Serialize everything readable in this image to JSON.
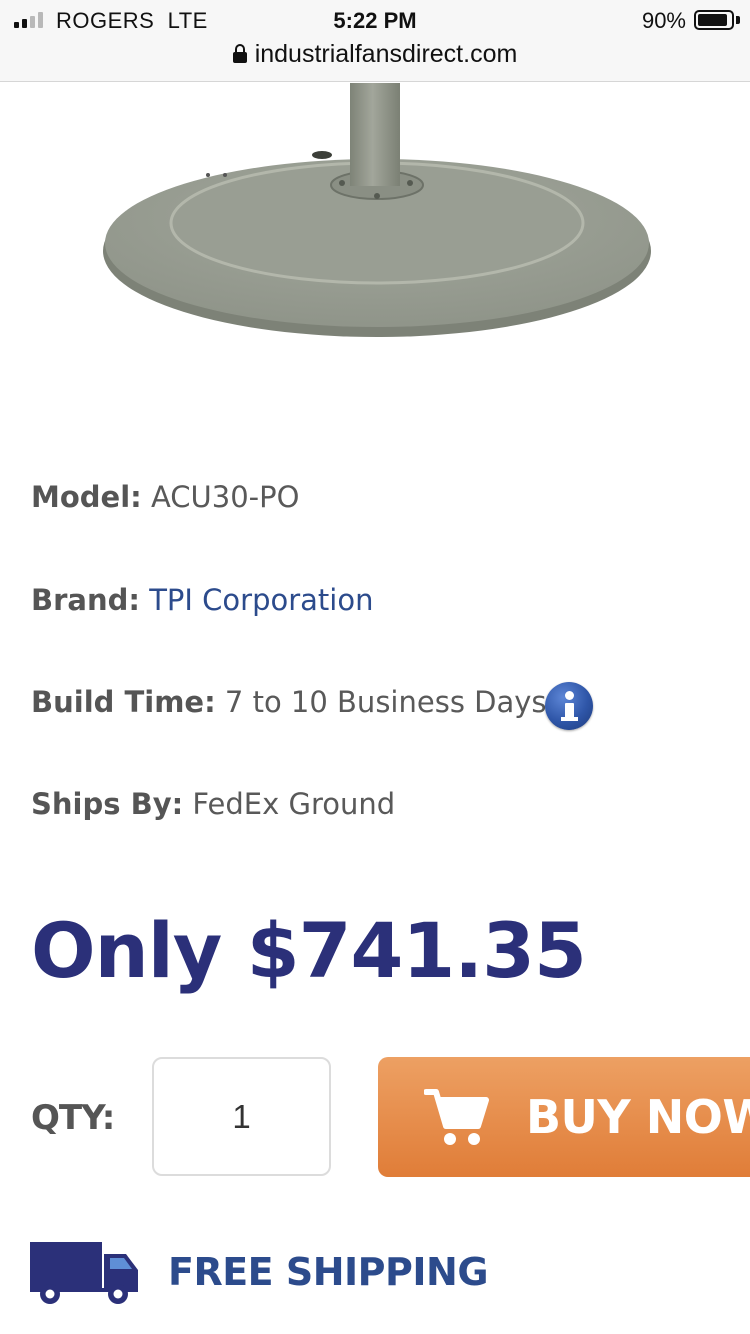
{
  "status_bar": {
    "carrier": "ROGERS",
    "network": "LTE",
    "time": "5:22 PM",
    "battery_percent": "90%",
    "battery_level": 0.9,
    "signal_bars_filled": 2,
    "signal_bars_total": 4
  },
  "browser": {
    "url": "industrialfansdirect.com"
  },
  "product": {
    "image_icon": "fan-pedestal-base-image",
    "specs": {
      "model_label": "Model:",
      "model_value": "ACU30-PO",
      "brand_label": "Brand:",
      "brand_value": "TPI Corporation",
      "build_time_label": "Build Time:",
      "build_time_value": "7 to 10 Business Days",
      "ships_by_label": "Ships By:",
      "ships_by_value": "FedEx Ground"
    },
    "price": "Only $741.35"
  },
  "purchase": {
    "qty_label": "QTY:",
    "qty_value": "1",
    "buy_label": "BUY NOW",
    "buy_icon": "shopping-cart-icon"
  },
  "shipping": {
    "icon": "delivery-truck-icon",
    "label": "FREE SHIPPING"
  },
  "colors": {
    "price_navy": "#2b3079",
    "link_blue": "#2c4b8c",
    "buy_orange": "#e8884a",
    "info_blue": "#2f56a8"
  }
}
